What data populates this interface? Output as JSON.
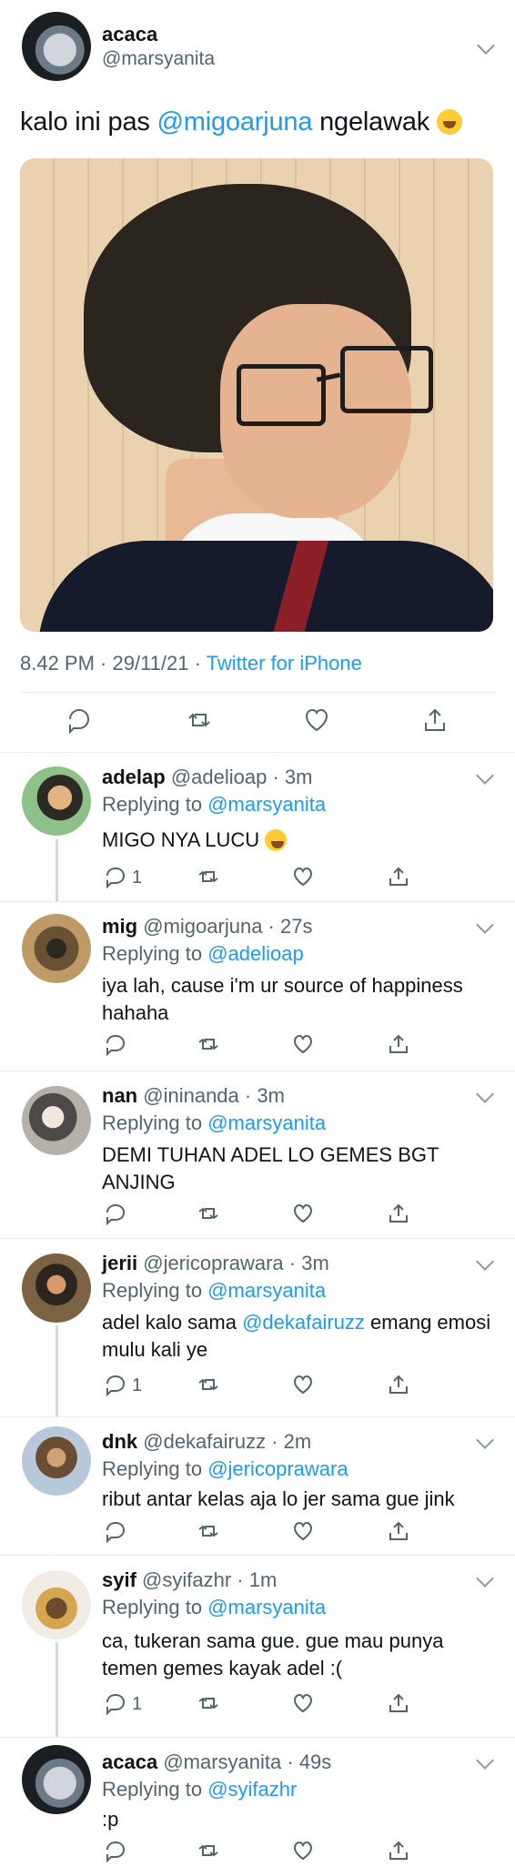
{
  "main": {
    "name": "acaca",
    "handle": "@marsyanita",
    "text_before": "kalo ini pas ",
    "mention": "@migoarjuna",
    "text_after": " ngelawak",
    "time_date": "8.42 PM · 29/11/21 · ",
    "source": "Twitter for iPhone"
  },
  "replies": [
    {
      "name": "adelap",
      "handle": "@adelioap",
      "time": "3m",
      "replying_prefix": "Replying to ",
      "replying_to": "@marsyanita",
      "text": "MIGO NYA LUCU",
      "reply_count": "1"
    },
    {
      "name": "mig",
      "handle": "@migoarjuna",
      "time": "27s",
      "replying_prefix": "Replying to ",
      "replying_to": "@adelioap",
      "text": "iya lah, cause i'm ur source of happiness hahaha",
      "reply_count": ""
    },
    {
      "name": "nan",
      "handle": "@ininanda",
      "time": "3m",
      "replying_prefix": "Replying to ",
      "replying_to": "@marsyanita",
      "text": "DEMI TUHAN ADEL LO GEMES BGT ANJING",
      "reply_count": ""
    },
    {
      "name": "jerii",
      "handle": "@jericoprawara",
      "time": "3m",
      "replying_prefix": "Replying to ",
      "replying_to": "@marsyanita",
      "text_before": "adel kalo sama ",
      "mention": "@dekafairuzz",
      "text_after": " emang emosi mulu kali ye",
      "reply_count": "1"
    },
    {
      "name": "dnk",
      "handle": "@dekafairuzz",
      "time": "2m",
      "replying_prefix": "Replying to ",
      "replying_to": "@jericoprawara",
      "text": "ribut antar kelas aja lo jer sama gue jink",
      "reply_count": ""
    },
    {
      "name": "syif",
      "handle": "@syifazhr",
      "time": "1m",
      "replying_prefix": "Replying to ",
      "replying_to": "@marsyanita",
      "text": "ca, tukeran sama gue. gue mau punya temen gemes kayak adel :(",
      "reply_count": "1"
    },
    {
      "name": "acaca",
      "handle": "@marsyanita",
      "time": "49s",
      "replying_prefix": "Replying to ",
      "replying_to": "@syifazhr",
      "text": ":p",
      "reply_count": ""
    }
  ],
  "icons": {
    "reply": "reply-icon",
    "retweet": "retweet-icon",
    "like": "heart-icon",
    "share": "share-icon",
    "more": "chevron-down-icon"
  },
  "colors": {
    "link": "#1d9bf0",
    "muted": "#536471",
    "line": "#cfd9de"
  }
}
